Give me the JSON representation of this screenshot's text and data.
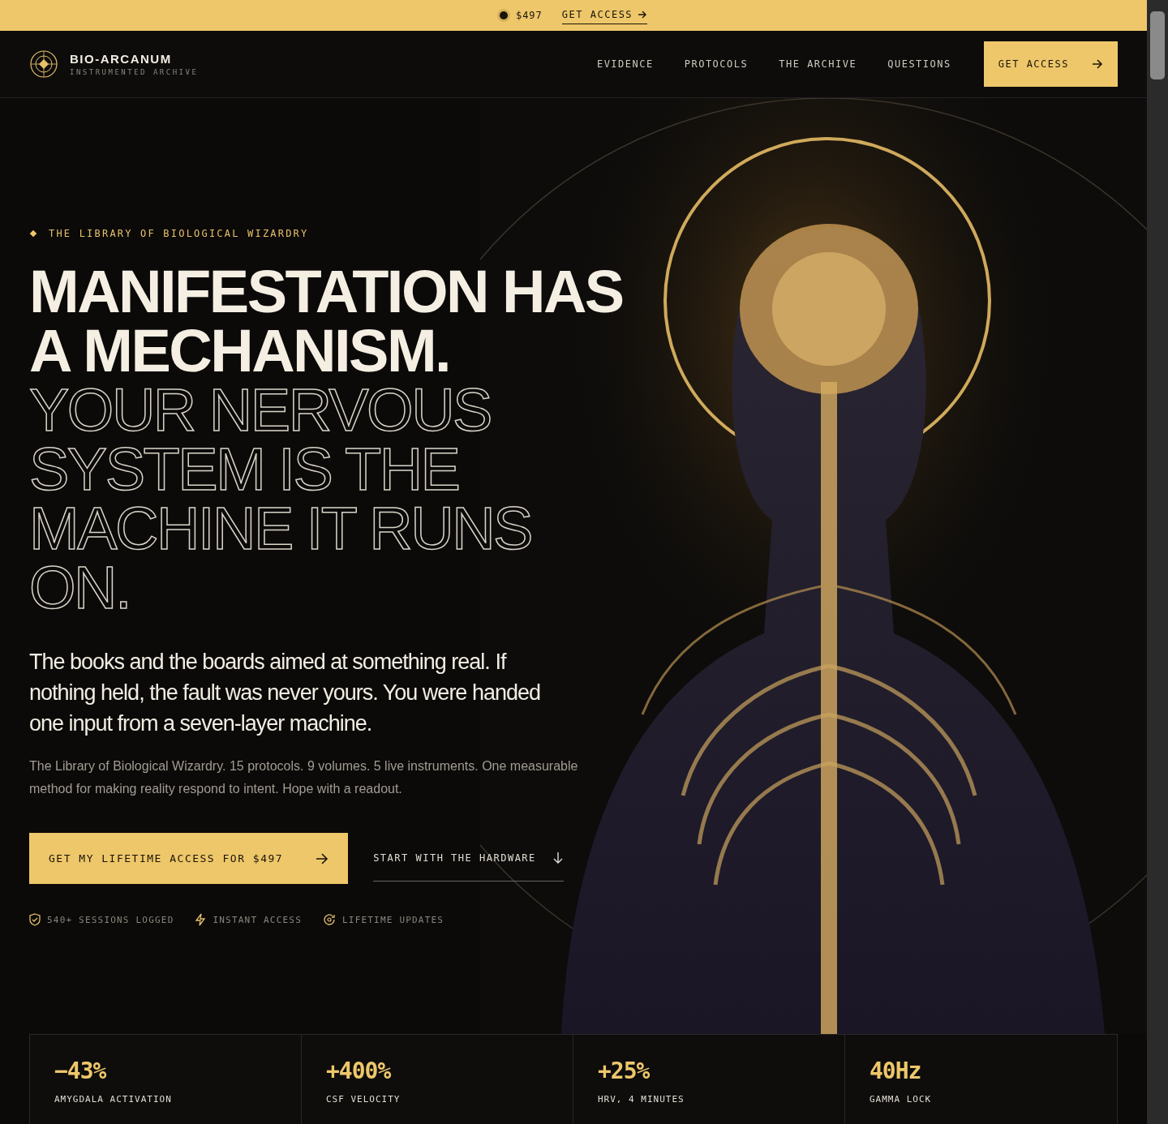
{
  "announcement": {
    "price": "$497",
    "link": "GET ACCESS"
  },
  "header": {
    "brand": "BIO-ARCANUM",
    "tagline": "INSTRUMENTED ARCHIVE",
    "nav": [
      {
        "label": "EVIDENCE"
      },
      {
        "label": "PROTOCOLS"
      },
      {
        "label": "THE ARCHIVE"
      },
      {
        "label": "QUESTIONS"
      }
    ],
    "cta": "GET ACCESS"
  },
  "hero": {
    "eyebrow": "THE LIBRARY OF BIOLOGICAL WIZARDRY",
    "headline_solid": "MANIFESTATION HAS A MECHANISM.",
    "headline_outline": "YOUR NERVOUS SYSTEM IS THE MACHINE IT RUNS ON.",
    "lead": "The books and the boards aimed at something real. If nothing held, the fault was never yours. You were handed one input from a seven-layer machine.",
    "body": "The Library of Biological Wizardry. 15 protocols. 9 volumes. 5 live instruments. One measurable method for making reality respond to intent. Hope with a readout.",
    "primary_button": "GET MY LIFETIME ACCESS FOR $497",
    "secondary_link": "START WITH THE HARDWARE",
    "badges": [
      {
        "kind": "shield",
        "label": "540+ SESSIONS LOGGED"
      },
      {
        "kind": "bolt",
        "label": "INSTANT ACCESS"
      },
      {
        "kind": "refresh",
        "label": "LIFETIME UPDATES"
      }
    ]
  },
  "stats": [
    {
      "value": "−43%",
      "label": "AMYGDALA ACTIVATION"
    },
    {
      "value": "+400%",
      "label": "CSF VELOCITY"
    },
    {
      "value": "+25%",
      "label": "HRV, 4 MINUTES"
    },
    {
      "value": "40Hz",
      "label": "GAMMA LOCK"
    }
  ]
}
